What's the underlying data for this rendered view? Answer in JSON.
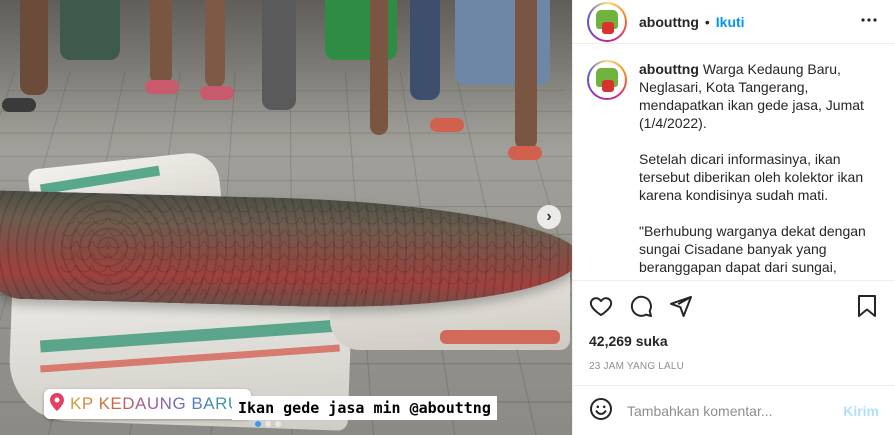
{
  "post": {
    "username": "abouttng",
    "separator": "•",
    "follow_label": "Ikuti",
    "more_icon": "more-horizontal-icon",
    "caption_paragraphs": [
      "Warga Kedaung Baru, Neglasari, Kota Tangerang, mendapatkan ikan gede jasa, Jumat (1/4/2022).",
      "Setelah dicari informasinya, ikan tersebut diberikan oleh kolektor ikan karena kondisinya sudah mati.",
      "\"Berhubung warganya dekat dengan sungai Cisadane banyak yang beranggapan dapat dari sungai, padahal"
    ],
    "likes": "42,269 suka",
    "timestamp": "23 jam yang lalu",
    "comment_placeholder": "Tambahkan komentar...",
    "post_label": "Kirim"
  },
  "photo": {
    "location_text": "KP KEDAUNG BARU",
    "caption_text": "Ikan gede jasa min @abouttng",
    "slide_count": 3,
    "active_slide": 1
  },
  "colors": {
    "link_blue": "#0095f6",
    "post_disabled": "#b2dffc",
    "meta_gray": "#8e8e8e",
    "border": "#efefef"
  }
}
